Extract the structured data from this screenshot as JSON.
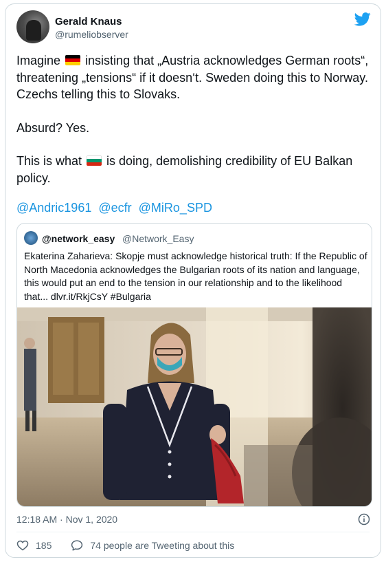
{
  "author": {
    "name": "Gerald Knaus",
    "handle": "@rumeliobserver"
  },
  "tweet": {
    "line1_a": "Imagine ",
    "line1_b": " insisting that „Austria acknowledges German roots“, threatening „tensions“ if it doesn‘t. Sweden doing this to Norway. Czechs telling this to Slovaks.",
    "line2": "Absurd? Yes.",
    "line3_a": "This is what ",
    "line3_b": " is doing, demolishing credibility of EU Balkan policy.",
    "flag1": "germany-flag",
    "flag2": "bulgaria-flag",
    "mentions": [
      "@Andric1961",
      "@ecfr",
      "@MiRo_SPD"
    ]
  },
  "quoted": {
    "name": "@network_easy",
    "handle": "@Network_Easy",
    "text": "Ekaterina Zaharieva: Skopje must acknowledge historical truth: If the Republic of North Macedonia acknowledges the Bulgarian roots of its nation and language, this would put an end to the tension in our relationship and to the likelihood that... dlvr.it/RkjCsY #Bulgaria"
  },
  "meta": {
    "timestamp": "12:18 AM · Nov 1, 2020"
  },
  "engagement": {
    "likes": "185",
    "talking": "74 people are Tweeting about this"
  },
  "colors": {
    "link": "#1b95e0",
    "twitter_blue": "#1da1f2",
    "like_red": "#e0245e",
    "muted": "#536471"
  },
  "icons": {
    "brand": "twitter-bird-icon",
    "info": "info-icon",
    "like": "heart-icon",
    "reply": "speech-bubble-icon"
  }
}
